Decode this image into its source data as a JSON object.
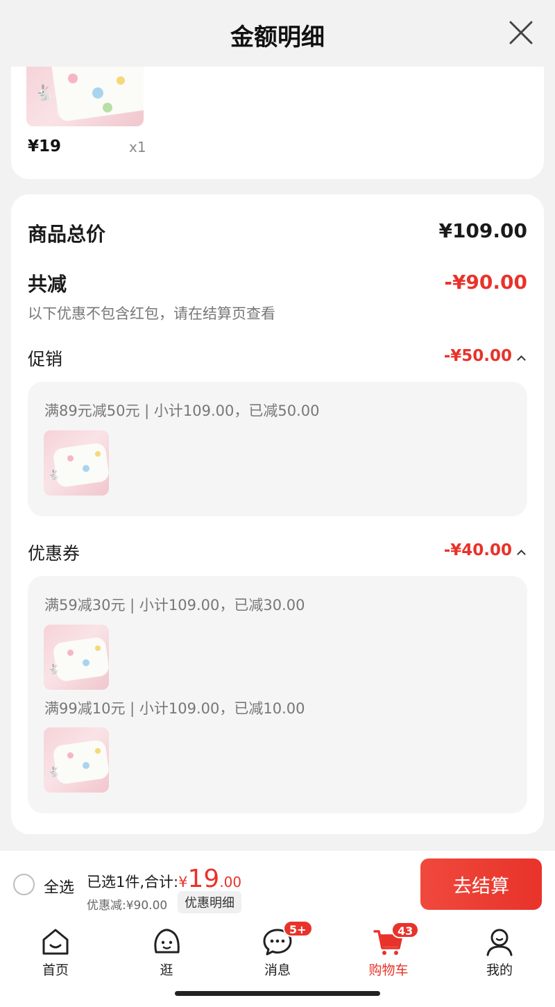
{
  "header": {
    "title": "金额明细"
  },
  "item": {
    "price": "¥19",
    "qty": "x1"
  },
  "summary": {
    "total_label": "商品总价",
    "total_value": "¥109.00",
    "reduce_label": "共减",
    "reduce_value": "-¥90.00",
    "note": "以下优惠不包含红包，请在结算页查看"
  },
  "promotion": {
    "label": "促销",
    "value": "-¥50.00",
    "rule": "满89元减50元 | 小计109.00，已减50.00"
  },
  "coupon": {
    "label": "优惠券",
    "value": "-¥40.00",
    "rules": [
      "满59减30元 | 小计109.00，已减30.00",
      "满99减10元 | 小计109.00，已减10.00"
    ]
  },
  "bottom": {
    "select_all": "全选",
    "selected_text": "已选1件,合计:",
    "currency": "¥",
    "total_int": "19",
    "total_dec": ".00",
    "discount_text": "优惠减:¥90.00",
    "detail_chip": "优惠明细",
    "checkout": "去结算"
  },
  "tabs": [
    {
      "label": "首页",
      "icon": "home-icon"
    },
    {
      "label": "逛",
      "icon": "browse-icon"
    },
    {
      "label": "消息",
      "icon": "message-icon",
      "badge": "5+"
    },
    {
      "label": "购物车",
      "icon": "cart-icon",
      "badge": "43",
      "active": true
    },
    {
      "label": "我的",
      "icon": "profile-icon"
    }
  ],
  "colors": {
    "accent": "#e8332a",
    "background": "#f2f2f2"
  }
}
